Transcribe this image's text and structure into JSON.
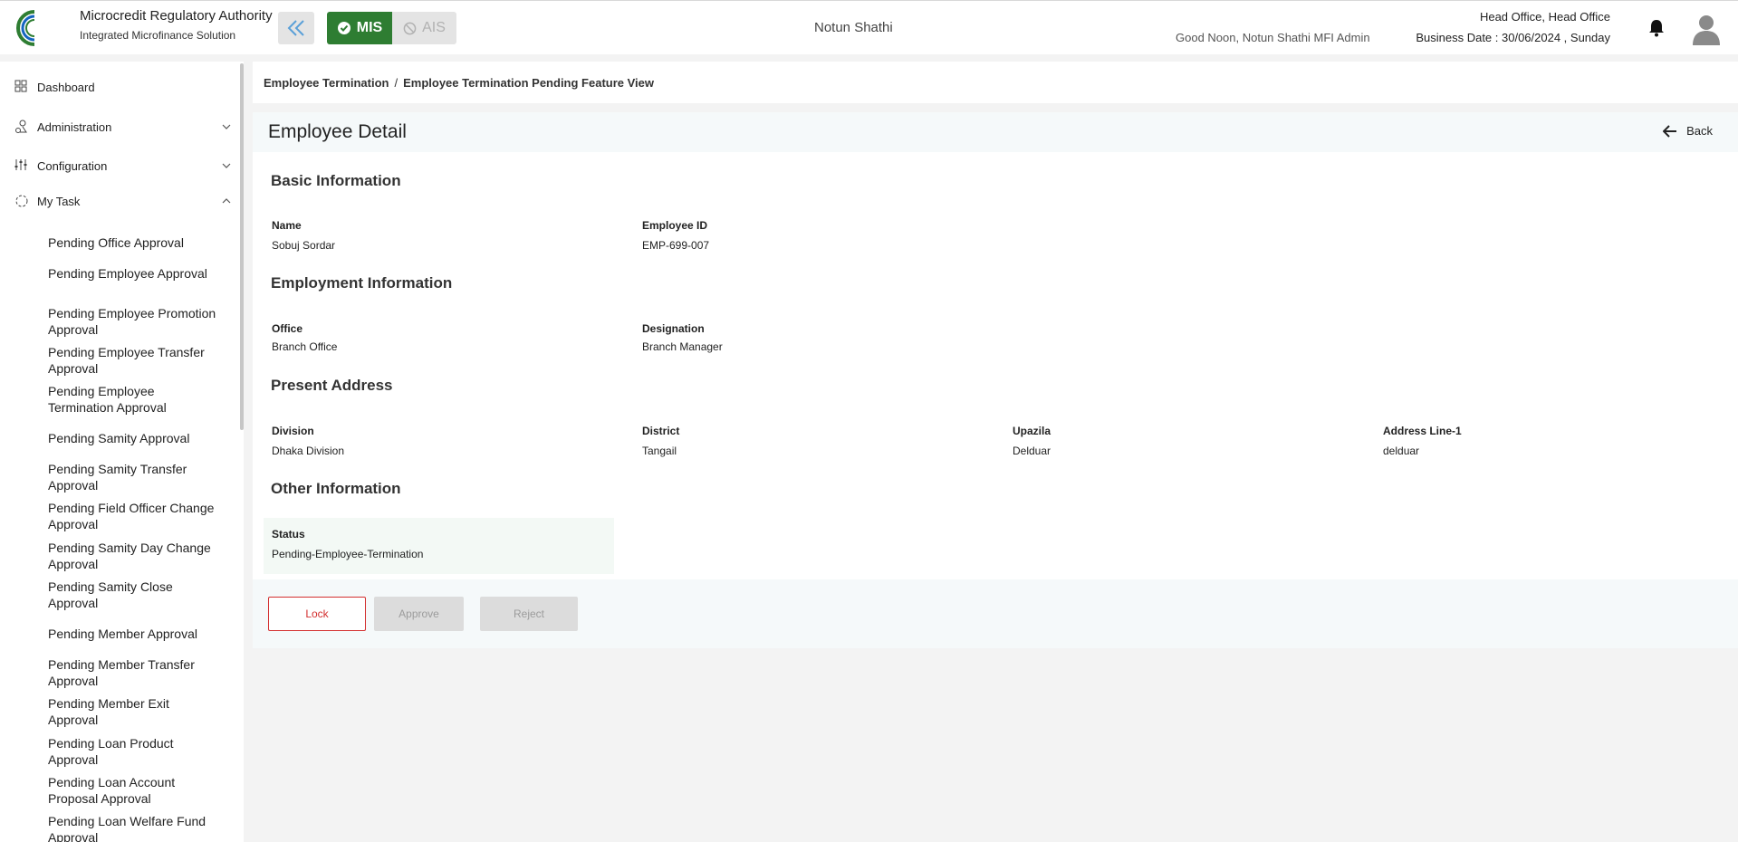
{
  "header": {
    "brand_title": "Microcredit Regulatory Authority",
    "brand_subtitle": "Integrated Microfinance Solution",
    "logo_text": "Microcredit Regulatory Authority",
    "mis_label": "MIS",
    "ais_label": "AIS",
    "org_name": "Notun Shathi",
    "greeting": "Good Noon, Notun Shathi MFI Admin",
    "office": "Head Office, Head Office",
    "business_date": "Business Date : 30/06/2024 , Sunday",
    "accent_color": "#2e7d32"
  },
  "sidebar": {
    "nav": [
      {
        "label": "Dashboard",
        "icon": "grid-icon"
      },
      {
        "label": "Administration",
        "icon": "admin-icon"
      },
      {
        "label": "Configuration",
        "icon": "sliders-icon"
      },
      {
        "label": "My Task",
        "icon": "task-icon"
      }
    ],
    "tasks": [
      "Pending Office Approval",
      "Pending Employee Approval",
      "Pending Employee Promotion Approval",
      "Pending Employee Transfer Approval",
      "Pending Employee Termination Approval",
      "Pending Samity Approval",
      "Pending Samity Transfer Approval",
      "Pending Field Officer Change Approval",
      "Pending Samity Day Change Approval",
      "Pending Samity Close Approval",
      "Pending Member Approval",
      "Pending Member Transfer Approval",
      "Pending Member Exit Approval",
      "Pending Loan Product Approval",
      "Pending Loan Account Proposal Approval",
      "Pending Loan Welfare Fund Approval"
    ]
  },
  "breadcrumb": {
    "parent": "Employee Termination",
    "separator": "/",
    "current": "Employee Termination Pending Feature View"
  },
  "detail": {
    "title": "Employee Detail",
    "back_label": "Back",
    "basic": {
      "title": "Basic Information",
      "name_label": "Name",
      "name_value": "Sobuj Sordar",
      "id_label": "Employee ID",
      "id_value": "EMP-699-007"
    },
    "employment": {
      "title": "Employment Information",
      "office_label": "Office",
      "office_value": "Branch Office",
      "designation_label": "Designation",
      "designation_value": "Branch Manager"
    },
    "address": {
      "title": "Present Address",
      "division_label": "Division",
      "division_value": "Dhaka Division",
      "district_label": "District",
      "district_value": "Tangail",
      "upazila_label": "Upazila",
      "upazila_value": "Delduar",
      "line1_label": "Address Line-1",
      "line1_value": "delduar"
    },
    "other": {
      "title": "Other Information",
      "status_label": "Status",
      "status_value": "Pending-Employee-Termination"
    }
  },
  "actions": {
    "lock": "Lock",
    "approve": "Approve",
    "reject": "Reject",
    "lock_color": "#d32f2f"
  }
}
